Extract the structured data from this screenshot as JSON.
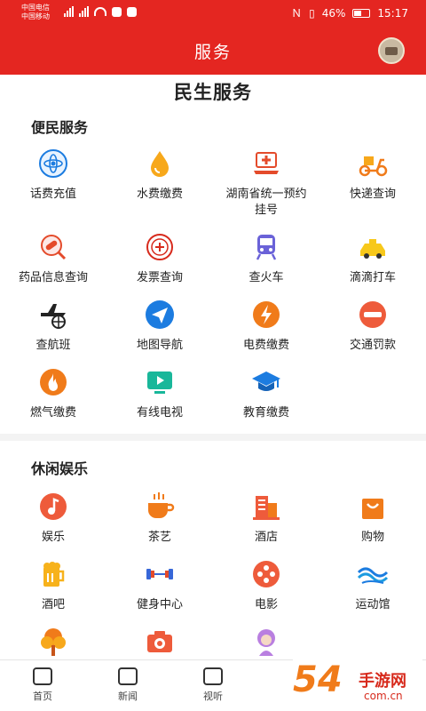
{
  "status": {
    "carrier1": "中国电信",
    "carrier2": "中国移动",
    "battery": "46%",
    "time": "15:17"
  },
  "nav": {
    "title": "服务"
  },
  "page_title": "民生服务",
  "sections": [
    {
      "title": "便民服务",
      "items": [
        {
          "label": "话费充值",
          "icon": "phone-recharge-icon"
        },
        {
          "label": "水费缴费",
          "icon": "water-drop-icon"
        },
        {
          "label": "湖南省统一预约挂号",
          "icon": "hospital-laptop-icon"
        },
        {
          "label": "快递查询",
          "icon": "delivery-scooter-icon"
        },
        {
          "label": "药品信息查询",
          "icon": "pill-search-icon"
        },
        {
          "label": "发票查询",
          "icon": "invoice-seal-icon"
        },
        {
          "label": "查火车",
          "icon": "train-icon"
        },
        {
          "label": "滴滴打车",
          "icon": "taxi-icon"
        },
        {
          "label": "查航班",
          "icon": "airplane-icon"
        },
        {
          "label": "地图导航",
          "icon": "navigation-arrow-icon"
        },
        {
          "label": "电费缴费",
          "icon": "lightning-icon"
        },
        {
          "label": "交通罚款",
          "icon": "no-entry-icon"
        },
        {
          "label": "燃气缴费",
          "icon": "flame-icon"
        },
        {
          "label": "有线电视",
          "icon": "tv-play-icon"
        },
        {
          "label": "教育缴费",
          "icon": "graduation-cap-icon"
        }
      ]
    },
    {
      "title": "休闲娱乐",
      "items": [
        {
          "label": "娱乐",
          "icon": "music-note-icon"
        },
        {
          "label": "茶艺",
          "icon": "tea-cup-icon"
        },
        {
          "label": "酒店",
          "icon": "hotel-building-icon"
        },
        {
          "label": "购物",
          "icon": "shopping-bag-icon"
        },
        {
          "label": "酒吧",
          "icon": "beer-mug-icon"
        },
        {
          "label": "健身中心",
          "icon": "dumbbell-icon"
        },
        {
          "label": "电影",
          "icon": "film-reel-icon"
        },
        {
          "label": "运动馆",
          "icon": "swim-wave-icon"
        },
        {
          "label": "",
          "icon": "tree-icon"
        },
        {
          "label": "",
          "icon": "camera-icon"
        },
        {
          "label": "",
          "icon": "beauty-icon"
        }
      ]
    }
  ],
  "tabs": [
    {
      "label": "首页",
      "icon": "home-icon"
    },
    {
      "label": "新闻",
      "icon": "news-icon"
    },
    {
      "label": "视听",
      "icon": "video-icon"
    }
  ],
  "watermark": {
    "big": "54",
    "title": "手游网",
    "sub": "com.cn"
  },
  "colors": {
    "brand": "#e42621"
  }
}
